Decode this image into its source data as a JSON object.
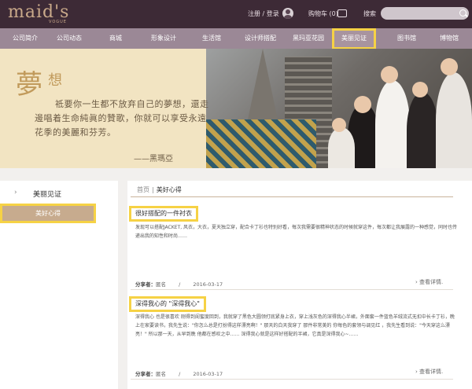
{
  "header": {
    "logo": "maid's",
    "logo_sub": "VOGUE",
    "login": "注册 / 登录",
    "cart": "购物车 (0)",
    "search_label": "搜索",
    "search_placeholder": ""
  },
  "nav": [
    {
      "label": "公司简介"
    },
    {
      "label": "公司动态"
    },
    {
      "label": "商城"
    },
    {
      "label": "形象设计"
    },
    {
      "label": "生活馆"
    },
    {
      "label": "设计师搭配"
    },
    {
      "label": "黑玛亚花园"
    },
    {
      "label": "美丽见证"
    },
    {
      "label": "图书馆"
    },
    {
      "label": "博物馆"
    }
  ],
  "banner": {
    "title_a": "夢",
    "title_b": "想",
    "lines": [
      "祗要你一生都不放弃自己的夢想，還走",
      "邊唱着生命純眞的贊歌，你就可以享受永遠",
      "花季的美麗和芬芳。"
    ],
    "signature": "——黑瑪亞"
  },
  "sidebar": {
    "heading": "美丽见证",
    "active": "美好心得"
  },
  "breadcrumb": {
    "home": "首页",
    "current": "美好心得"
  },
  "articles": [
    {
      "title": "很好搭配的一件衬衣",
      "body": "发现可以搭配JACKET, 风衣，大衣，夏天独立穿，配合卡丁衫也特别好看，每次我需要很精神状态的时候就穿这件，每次都让我展露的一种感觉，同时也传递出我的知性和时尚……",
      "author_label": "分享者：",
      "author": "匿名",
      "date": "2016-03-17",
      "more": "查看详情."
    },
    {
      "title": "深得我心的 \"深得我心\"",
      "body": "深得我心 也是很喜欢 刚得到闺蜜度回到，我就穿了黑色大圆领打底紧身上衣，穿上浅灰色的深得我心半裙，外面套一件蓝色羊绒流式无扣中长卡丁衫，晚上在家要读书，我先生说：\"你怎么总是打扮得这样漂亮啊！\" 那天的白天我穿了 那件非常美的 你每色的套领与调见红 ，我先生看到说：\"今天穿这么漂亮！\" 所以那一天，从早到晚 他都在感叹之中…… 深得我心就是这样好搭配的半裙，它真是深得我心~……",
      "author_label": "分享者：",
      "author": "匿名",
      "date": "2016-03-17",
      "more": "查看详情."
    }
  ],
  "colors": {
    "header_bg": "#3d2a36",
    "nav_bg": "#9b8896",
    "highlight": "#f6d245",
    "accent_gold": "#c19a5b"
  }
}
